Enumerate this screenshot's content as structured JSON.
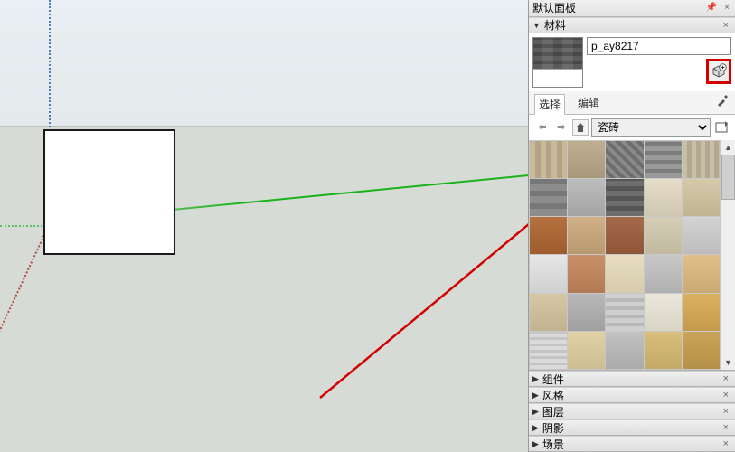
{
  "panel": {
    "title": "默认面板",
    "sections": {
      "materials": {
        "label": "材料",
        "expanded": true
      },
      "components": {
        "label": "组件"
      },
      "styles": {
        "label": "风格"
      },
      "layers": {
        "label": "图层"
      },
      "shadows": {
        "label": "阴影"
      },
      "scenes": {
        "label": "场景"
      }
    }
  },
  "materials": {
    "name_value": "p_ay8217",
    "tabs": {
      "select": "选择",
      "edit": "编辑"
    },
    "library_selected": "瓷砖",
    "swatches": [
      {
        "id": "t00",
        "bg": "repeating-linear-gradient(90deg,#c9b99a 0 6px,#b3a385 6px 12px)"
      },
      {
        "id": "t01",
        "bg": "linear-gradient(#bfae90,#a8987a)"
      },
      {
        "id": "t02",
        "bg": "repeating-linear-gradient(45deg,#8a8a8a 0 4px,#6d6d6d 4px 8px)"
      },
      {
        "id": "t03",
        "bg": "repeating-linear-gradient(0deg,#9a9a9a 0 6px,#7d7d7d 6px 10px)"
      },
      {
        "id": "t04",
        "bg": "repeating-linear-gradient(90deg,#c9bfa6 0 5px,#b3a98f 5px 10px)"
      },
      {
        "id": "t05",
        "bg": "repeating-linear-gradient(0deg,#8d8d8d 0 8px,#777 8px 14px)"
      },
      {
        "id": "t06",
        "bg": "linear-gradient(#bdbdbd,#a3a3a3)"
      },
      {
        "id": "t07",
        "bg": "repeating-linear-gradient(0deg,#6d6d6d 0 6px,#555 6px 11px)"
      },
      {
        "id": "t08",
        "bg": "linear-gradient(#e6ddc8,#cfc6b1)"
      },
      {
        "id": "t09",
        "bg": "linear-gradient(#d4c9a8,#c0b593)"
      },
      {
        "id": "t10",
        "bg": "linear-gradient(#b5713f,#9e5d2e)"
      },
      {
        "id": "t11",
        "bg": "linear-gradient(#d0b086,#b99a70)"
      },
      {
        "id": "t12",
        "bg": "linear-gradient(#a56a4a,#8e5538)"
      },
      {
        "id": "t13",
        "bg": "linear-gradient(#d5cdb5,#c2ba9f)"
      },
      {
        "id": "t14",
        "bg": "linear-gradient(#d4d4d4,#bcbcbc)"
      },
      {
        "id": "t15",
        "bg": "linear-gradient(#e6e6e6,#d0d0d0)"
      },
      {
        "id": "t16",
        "bg": "linear-gradient(#c98f68,#b37a54)"
      },
      {
        "id": "t17",
        "bg": "linear-gradient(#e8ddc0,#d6cbad)"
      },
      {
        "id": "t18",
        "bg": "linear-gradient(#c8c8c8,#b0b0b0)"
      },
      {
        "id": "t19",
        "bg": "linear-gradient(#e0c088,#c9aa72)"
      },
      {
        "id": "t20",
        "bg": "linear-gradient(#d6c7a5,#c2b390)"
      },
      {
        "id": "t21",
        "bg": "linear-gradient(#b8b8b8,#a0a0a0)"
      },
      {
        "id": "t22",
        "bg": "repeating-linear-gradient(0deg,#cfcfcf 0 5px,#b8b8b8 5px 9px)"
      },
      {
        "id": "t23",
        "bg": "linear-gradient(#ebe7da,#d8d4c6)"
      },
      {
        "id": "t24",
        "bg": "linear-gradient(#dbb060,#c49a4c)"
      },
      {
        "id": "t25",
        "bg": "repeating-linear-gradient(0deg,#dadada 0 4px,#c4c4c4 4px 7px)"
      },
      {
        "id": "t26",
        "bg": "linear-gradient(#e0d2a6,#ccbe92)"
      },
      {
        "id": "t27",
        "bg": "linear-gradient(#c2c2c2,#aaaaaa)"
      },
      {
        "id": "t28",
        "bg": "linear-gradient(#d8be7a,#c3aa66)"
      },
      {
        "id": "t29",
        "bg": "linear-gradient(#c9a55a,#b49148)"
      }
    ]
  },
  "icons": {
    "pin": "📌",
    "close": "×",
    "tri_open": "▼",
    "tri_closed": "▶"
  }
}
